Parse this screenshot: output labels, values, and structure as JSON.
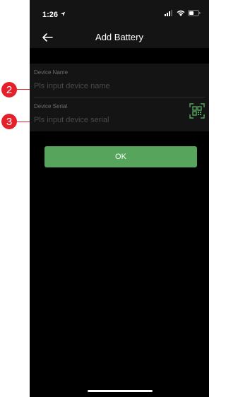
{
  "status_bar": {
    "time": "1:26",
    "location_icon": "location-arrow-icon",
    "signal_icon": "cellular-signal-icon",
    "wifi_icon": "wifi-icon",
    "battery_icon": "battery-icon"
  },
  "nav": {
    "back_icon": "back-arrow-icon",
    "title": "Add Battery"
  },
  "form": {
    "device_name": {
      "label": "Device Name",
      "placeholder": "Pls input device name",
      "value": ""
    },
    "device_serial": {
      "label": "Device Serial",
      "placeholder": "Pls input device serial",
      "value": "",
      "scan_icon": "qr-scan-icon"
    }
  },
  "ok_button": {
    "label": "OK"
  },
  "annotations": {
    "marker_2": "2",
    "marker_3": "3"
  },
  "colors": {
    "accent": "#57a55d",
    "marker": "#e4202a",
    "background": "#000000",
    "panel": "#141414"
  }
}
